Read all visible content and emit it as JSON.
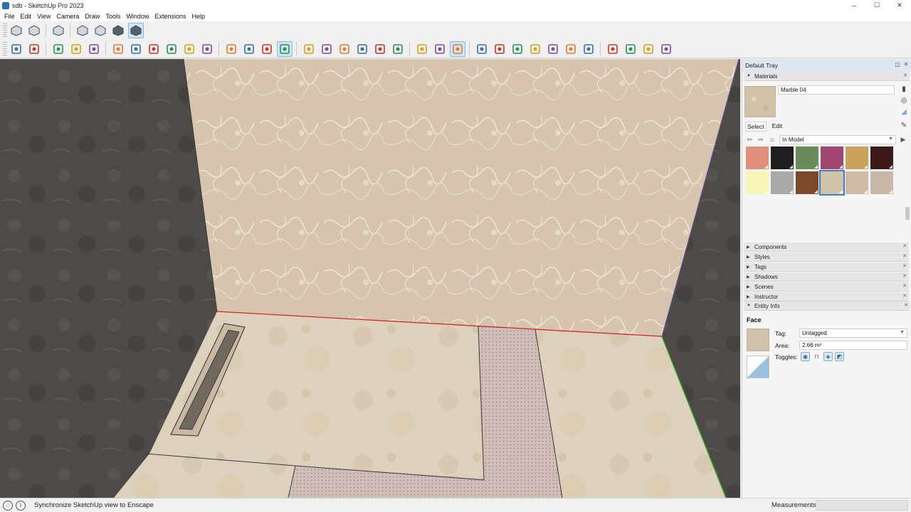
{
  "window": {
    "title": "sdb - SketchUp Pro 2023",
    "controls": [
      "─",
      "☐",
      "✕"
    ]
  },
  "menu": [
    "File",
    "Edit",
    "View",
    "Camera",
    "Draw",
    "Tools",
    "Window",
    "Extensions",
    "Help"
  ],
  "toolbar1": [
    {
      "name": "iso-view-icon"
    },
    {
      "name": "top-view-icon"
    },
    {
      "name": "front-view-icon"
    },
    {
      "name": "xray-style-icon"
    },
    {
      "name": "wireframe-style-icon"
    },
    {
      "name": "shaded-style-icon"
    },
    {
      "name": "textured-style-icon",
      "active": true
    }
  ],
  "toolbar2": [
    "search-icon",
    "select-arrow-icon",
    "eraser-icon",
    "pencil-line-icon",
    "shape-icon",
    "push-pull-icon",
    "paint-bucket-icon",
    "move-icon",
    "rotate-icon",
    "scale-icon",
    "offset-icon",
    "tape-measure-icon",
    "text-icon",
    "orbit-icon",
    "pan-icon",
    "zoom-icon",
    "zoom-extents-icon",
    "section-plane-icon",
    "layers-icon",
    "sandbox-icon",
    "stack-icon",
    "user-account-icon",
    "warehouse-icon",
    "scene-icon",
    "camera-icon",
    "add-location-icon",
    "geo-icon",
    "report-icon",
    "grid-icon",
    "cloud-icon",
    "extension-manager-icon",
    "folder-icon",
    "info-icon",
    "shop-icon",
    "profile-icon"
  ],
  "tray": {
    "title": "Default Tray",
    "materials": {
      "panel_title": "Materials",
      "current_name": "Marble 04",
      "tabs": [
        "Select",
        "Edit"
      ],
      "library": "In Model",
      "swatches": [
        {
          "color": "#e0907a"
        },
        {
          "color": "#1e1e1e"
        },
        {
          "color": "#6a8a5c"
        },
        {
          "color": "#a0476f"
        },
        {
          "color": "#c9a35e"
        },
        {
          "color": "#3c1a1c"
        },
        {
          "color": "#f6f6b8"
        },
        {
          "color": "#a9a9a9"
        },
        {
          "color": "#7a4a26"
        },
        {
          "color": "#d2c2a8",
          "selected": true
        },
        {
          "color": "#cdbba6"
        },
        {
          "color": "#c7b8aa"
        }
      ]
    },
    "collapsed_panels": [
      "Components",
      "Styles",
      "Tags",
      "Shadows",
      "Scenes",
      "Instructor"
    ],
    "entity_info": {
      "panel_title": "Entity Info",
      "entity_type": "Face",
      "tag_label": "Tag:",
      "tag_value": "Untagged",
      "area_label": "Area:",
      "area_value": "2.66 m²",
      "toggles_label": "Toggles:"
    }
  },
  "status": {
    "message": "Synchronize SketchUp view to Enscape",
    "measurements_label": "Measurements"
  }
}
